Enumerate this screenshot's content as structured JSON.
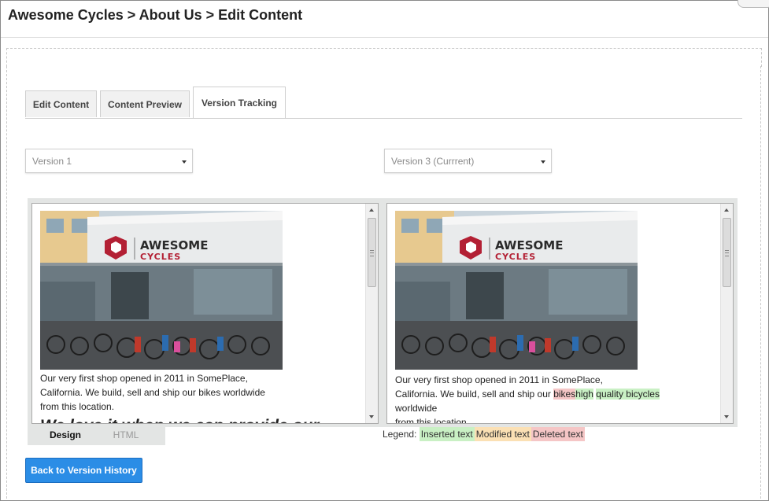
{
  "header": {
    "breadcrumb": "Awesome Cycles > About Us > Edit Content"
  },
  "tabs": [
    {
      "label": "Edit Content",
      "active": false
    },
    {
      "label": "Content Preview",
      "active": false
    },
    {
      "label": "Version Tracking",
      "active": true
    }
  ],
  "versions": {
    "left_selected": "Version 1",
    "right_selected": "Version 3 (Currrent)"
  },
  "left_pane": {
    "logo_top": "AWESOME",
    "logo_bottom": "CYCLES",
    "paragraph_lines": [
      "Our very first shop opened in 2011 in SomePlace,",
      "California. We build, sell and ship our bikes worldwide",
      "from this location."
    ],
    "heading_partial": "We love it when we can provide our"
  },
  "right_pane": {
    "logo_top": "AWESOME",
    "logo_bottom": "CYCLES",
    "line1": "Our very first shop opened in 2011 in SomePlace,",
    "line2_prefix": "California. We build, sell and ship our ",
    "line2_deleted": "bikes",
    "line2_inserted_a": "high",
    "line2_inserted_b": "quality bicycles",
    "line3": "worldwide",
    "line4": "from this location."
  },
  "view_modes": {
    "design_label": "Design",
    "html_label": "HTML",
    "active": "Design"
  },
  "legend": {
    "label": "Legend:",
    "inserted": "Inserted text",
    "modified": "Modified text",
    "deleted": "Deleted text"
  },
  "actions": {
    "back_label": "Back to Version History"
  },
  "colors": {
    "inserted": "#c9f0c4",
    "modified": "#fbe0b4",
    "deleted": "#f5c6c6",
    "button_blue": "#2b8de6"
  }
}
